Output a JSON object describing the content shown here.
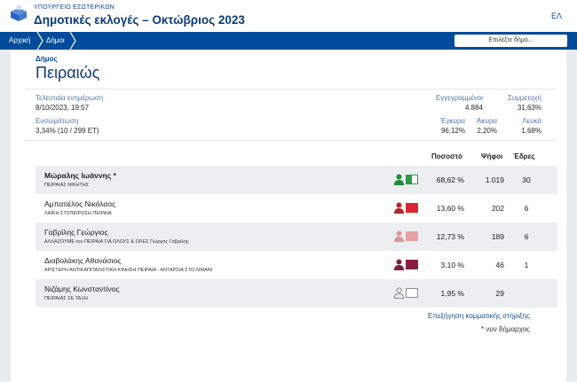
{
  "header": {
    "ministry": "ΥΠΟΥΡΓΕΙΟ ΕΣΩΤΕΡΙΚΩΝ",
    "title": "Δημοτικές εκλογές – Οκτώβριος 2023",
    "language": "ΕΛ"
  },
  "nav": {
    "home": "Αρχική",
    "municipalities": "Δήμοι",
    "select_placeholder": "Επιλέξτε δήμο..."
  },
  "municipality": {
    "label": "Δήμος",
    "name": "Πειραιώς"
  },
  "stats": {
    "last_update_label": "Τελευταία ενημέρωση",
    "last_update_value": "8/10/2023, 19:57",
    "integration_label": "Ενσωμάτωση",
    "integration_value": "3,34% (10 / 299 ΕΤ)",
    "registered_label": "Εγγεγραμμένοι",
    "registered_value": "4.884",
    "turnout_label": "Συμμετοχή",
    "turnout_value": "31,63%",
    "valid_label": "Έγκυρα",
    "valid_value": "96,12%",
    "invalid_label": "Άκυρα",
    "invalid_value": "2,20%",
    "blank_label": "Λευκά",
    "blank_value": "1,68%"
  },
  "table": {
    "headers": {
      "percent": "Ποσοστό",
      "votes": "Ψήφοι",
      "seats": "Έδρες"
    },
    "rows": [
      {
        "candidate": "Μώραλης Ιωάννης *",
        "party": "ΠΕΙΡΑΙΑΣ ΝΙΚΗΤΗΣ",
        "percent": "68,62 %",
        "votes": "1.019",
        "seats": "30",
        "person_color": "#1b8a3a",
        "swatch_color": "#2e9a46",
        "swatch_style": "split"
      },
      {
        "candidate": "Αμπατιέλος Νικόλαος",
        "party": "ΛΑΪΚΗ ΣΥΣΠΕΙΡΩΣΗ ΠΕΙΡΑΙΑ",
        "percent": "13,60 %",
        "votes": "202",
        "seats": "6",
        "person_color": "#b5252c",
        "swatch_color": "#d9262e",
        "swatch_style": "solid"
      },
      {
        "candidate": "Γαβρίλης Γεώργιος",
        "party": "ΑΛΛΑΖΟΥΜΕ τον ΠΕΙΡΑΙΑ ΓΙΑ ΟΛΟΥΣ & ΟΛΕΣ Γιώργος Γαβρίλης",
        "percent": "12,73 %",
        "votes": "189",
        "seats": "6",
        "person_color": "#de9595",
        "swatch_color": "#e7a1a1",
        "swatch_style": "solid"
      },
      {
        "candidate": "Διαβολάκης Αθανάσιος",
        "party": "ΑΡΙΣΤΕΡΗ ΑΝΤΙΚΑΠΙΤΑΛΙΣΤΙΚΗ ΚΙΝΗΣΗ ΠΕΙΡΑΙΑ - ΑΝΤΑΡΣΙΑ ΣΤΟ ΛΙΜΑΝΙ",
        "percent": "3,10 %",
        "votes": "46",
        "seats": "1",
        "person_color": "#7a1f3a",
        "swatch_color": "#8a1f40",
        "swatch_style": "solid"
      },
      {
        "candidate": "Νιζάμης Κωνσταντίνος",
        "party": "ΠΕΙΡΑΙΑΣ ΣΕ ΤΑΞΗ",
        "percent": "1,95 %",
        "votes": "29",
        "seats": "",
        "person_color": "#8d8d8d",
        "swatch_color": "#ffffff",
        "swatch_style": "outline"
      }
    ]
  },
  "footer": {
    "link": "Επεξήγηση κομματικής στήριξης",
    "note": "* νυν δήμαρχος"
  }
}
